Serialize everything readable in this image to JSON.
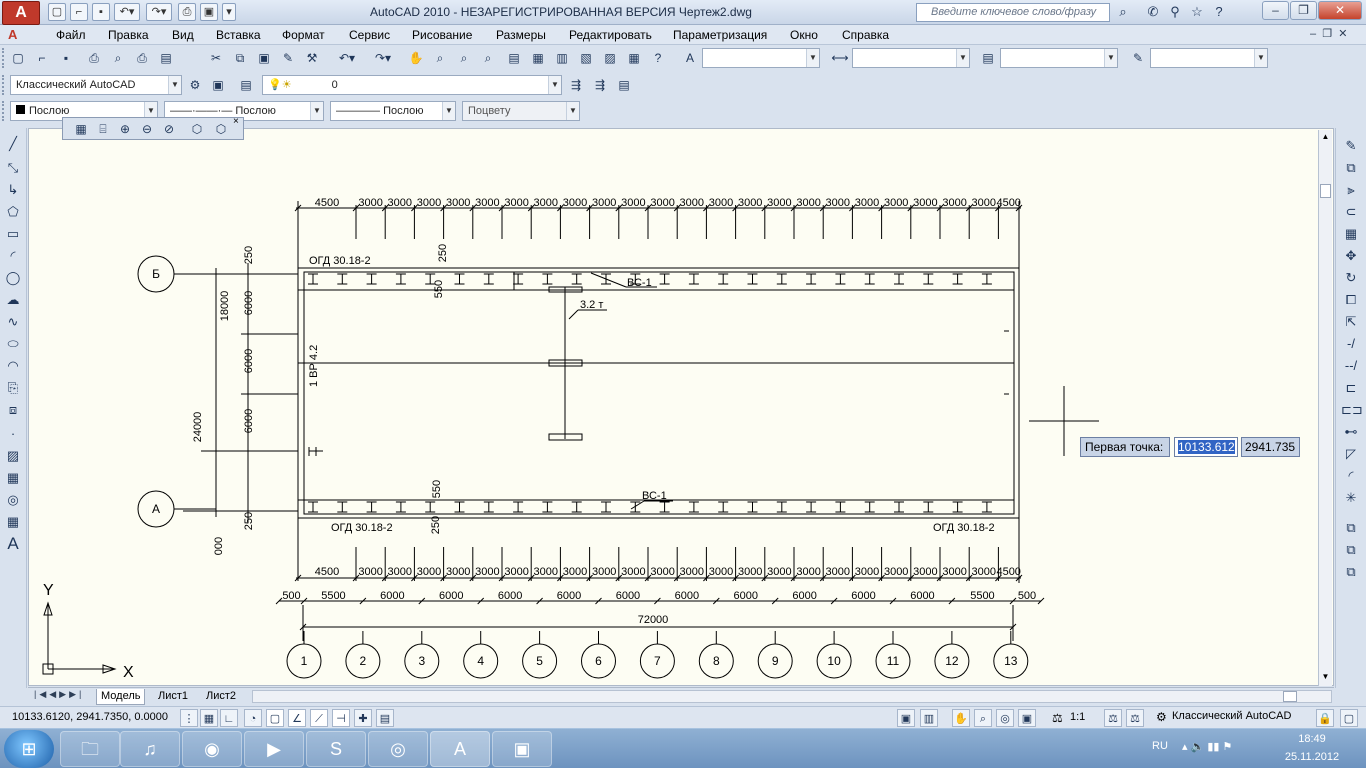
{
  "title": {
    "window_title": "AutoCAD 2010 - НЕЗАРЕГИСТРИРОВАННАЯ ВЕРСИЯ      Чертеж2.dwg",
    "search_placeholder": "Введите ключевое слово/фразу",
    "logo": "A"
  },
  "menu": [
    "Файл",
    "Правка",
    "Вид",
    "Вставка",
    "Формат",
    "Сервис",
    "Рисование",
    "Размеры",
    "Редактировать",
    "Параметризация",
    "Окно",
    "Справка"
  ],
  "toolbars": {
    "workspace": "Классический AutoCAD",
    "layer": "0",
    "color": "Послою",
    "linetype": "Послою",
    "lineweight": "Послою",
    "plotstyle": "Поцвету"
  },
  "tabs": [
    "Модель",
    "Лист1",
    "Лист2"
  ],
  "status": {
    "coords": "10133.6120, 2941.7350, 0.0000",
    "scale": "1:1",
    "workspace": "Классический AutoCAD"
  },
  "dynamic_input": {
    "label": "Первая точка:",
    "x": "10133.612",
    "y": "2941.735"
  },
  "drawing": {
    "grid_labels": [
      "1",
      "2",
      "3",
      "4",
      "5",
      "6",
      "7",
      "8",
      "9",
      "10",
      "11",
      "12",
      "13"
    ],
    "row_labels": [
      "Б",
      "А"
    ],
    "top_dims": [
      "4500",
      "3000",
      "3000",
      "3000",
      "3000",
      "3000",
      "3000",
      "3000",
      "3000",
      "3000",
      "3000",
      "3000",
      "3000",
      "3000",
      "3000",
      "3000",
      "3000",
      "3000",
      "3000",
      "3000",
      "3000",
      "3000",
      "3000",
      "4500"
    ],
    "bottom_dims_1": [
      "4500",
      "3000",
      "3000",
      "3000",
      "3000",
      "3000",
      "3000",
      "3000",
      "3000",
      "3000",
      "3000",
      "3000",
      "3000",
      "3000",
      "3000",
      "3000",
      "3000",
      "3000",
      "3000",
      "3000",
      "3000",
      "3000",
      "3000",
      "4500"
    ],
    "bottom_dims_2": [
      "500",
      "5500",
      "6000",
      "6000",
      "6000",
      "6000",
      "6000",
      "6000",
      "6000",
      "6000",
      "6000",
      "6000",
      "5500",
      "500"
    ],
    "total": "72000",
    "left_dims": [
      "250",
      "6000",
      "6000",
      "6000",
      "250"
    ],
    "left_total_a": "18000",
    "left_total_b": "24000",
    "left_zero": "000",
    "beam_labels": [
      "ОГД 30.18-2",
      "ОГД 30.18-2",
      "ОГД 30.18-2"
    ],
    "bc_labels": [
      "ВС-1",
      "ВС-1"
    ],
    "crane_label": "3.2 т",
    "vr_label": "1 ВР 4.2",
    "small_dims": [
      "250",
      "550",
      "550",
      "250"
    ],
    "ucs_x": "X",
    "ucs_y": "Y"
  },
  "taskbar": {
    "lang": "RU",
    "time": "18:49",
    "date": "25.11.2012"
  }
}
